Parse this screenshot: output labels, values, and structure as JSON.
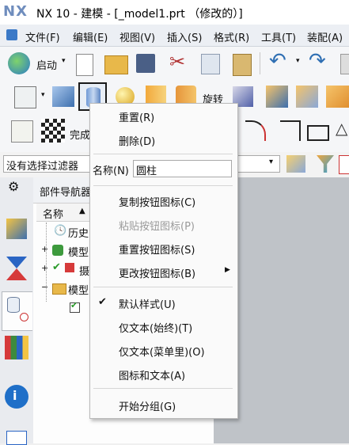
{
  "app": {
    "logo": "NX",
    "window_title": "NX 10 - 建模 - [_model1.prt （修改的）]"
  },
  "menubar": {
    "items": [
      "文件(F)",
      "编辑(E)",
      "视图(V)",
      "插入(S)",
      "格式(R)",
      "工具(T)",
      "装配(A)"
    ]
  },
  "toolbar1": {
    "start_label": "启动",
    "icons": [
      "start-icon",
      "new-file-icon",
      "open-folder-icon",
      "save-icon",
      "cut-icon",
      "copy-icon",
      "paste-icon",
      "undo-icon",
      "redo-icon"
    ]
  },
  "toolbar2": {
    "rotate_label": "旋转"
  },
  "toolbar3": {
    "finish_label": "完成"
  },
  "filter": {
    "value": "没有选择过滤器"
  },
  "navigator": {
    "title": "部件导航器",
    "column_name": "名称",
    "tree": [
      "历史",
      "模型",
      "摄",
      "模型"
    ]
  },
  "context_menu": {
    "reset": "重置(R)",
    "delete": "删除(D)",
    "name_label": "名称(N)",
    "name_value": "圆柱",
    "copy_icon": "复制按钮图标(C)",
    "paste_icon": "粘贴按钮图标(P)",
    "reset_icon": "重置按钮图标(S)",
    "change_icon": "更改按钮图标(B)",
    "default_style": "默认样式(U)",
    "text_only_always": "仅文本(始终)(T)",
    "text_only_menu": "仅文本(菜单里)(O)",
    "icon_and_text": "图标和文本(A)",
    "start_group": "开始分组(G)"
  },
  "colors": {
    "accent": "#2f6fb3",
    "title_logo": "#6f8dbd"
  }
}
